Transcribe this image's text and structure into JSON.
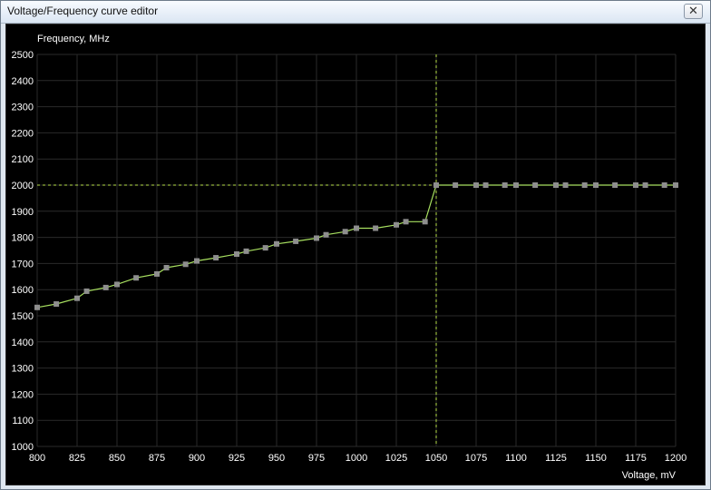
{
  "window": {
    "title": "Voltage/Frequency curve editor",
    "close_glyph": "✕"
  },
  "chart_data": {
    "type": "line",
    "xlabel": "Voltage, mV",
    "ylabel": "Frequency, MHz",
    "xlim": [
      800,
      1200
    ],
    "ylim": [
      1000,
      2500
    ],
    "x_ticks": [
      800,
      825,
      850,
      875,
      900,
      925,
      950,
      975,
      1000,
      1025,
      1050,
      1075,
      1100,
      1125,
      1150,
      1175,
      1200
    ],
    "y_ticks": [
      1000,
      1100,
      1200,
      1300,
      1400,
      1500,
      1600,
      1700,
      1800,
      1900,
      2000,
      2100,
      2200,
      2300,
      2400,
      2500
    ],
    "grid": true,
    "selected_point": {
      "x": 1050,
      "y": 2000
    },
    "colors": {
      "curve": "#a8e060",
      "point": "#8e8e8e",
      "grid": "#2a2a2a",
      "cursor": "#b8e04a",
      "axis_text": "#ffffff"
    },
    "series": [
      {
        "points": [
          [
            800,
            1532
          ],
          [
            812,
            1545
          ],
          [
            825,
            1567
          ],
          [
            831,
            1594
          ],
          [
            843,
            1608
          ],
          [
            850,
            1620
          ],
          [
            862,
            1645
          ],
          [
            875,
            1660
          ],
          [
            881,
            1684
          ],
          [
            893,
            1697
          ],
          [
            900,
            1710
          ],
          [
            912,
            1722
          ],
          [
            925,
            1736
          ],
          [
            931,
            1747
          ],
          [
            943,
            1760
          ],
          [
            950,
            1775
          ],
          [
            962,
            1785
          ],
          [
            975,
            1797
          ],
          [
            981,
            1810
          ],
          [
            993,
            1822
          ],
          [
            1000,
            1835
          ],
          [
            1012,
            1835
          ],
          [
            1025,
            1848
          ],
          [
            1031,
            1860
          ],
          [
            1043,
            1860
          ],
          [
            1050,
            2000
          ],
          [
            1062,
            2000
          ],
          [
            1075,
            2000
          ],
          [
            1081,
            2000
          ],
          [
            1093,
            2000
          ],
          [
            1100,
            2000
          ],
          [
            1112,
            2000
          ],
          [
            1125,
            2000
          ],
          [
            1131,
            2000
          ],
          [
            1143,
            2000
          ],
          [
            1150,
            2000
          ],
          [
            1162,
            2000
          ],
          [
            1175,
            2000
          ],
          [
            1181,
            2000
          ],
          [
            1193,
            2000
          ],
          [
            1200,
            2000
          ]
        ]
      }
    ]
  }
}
